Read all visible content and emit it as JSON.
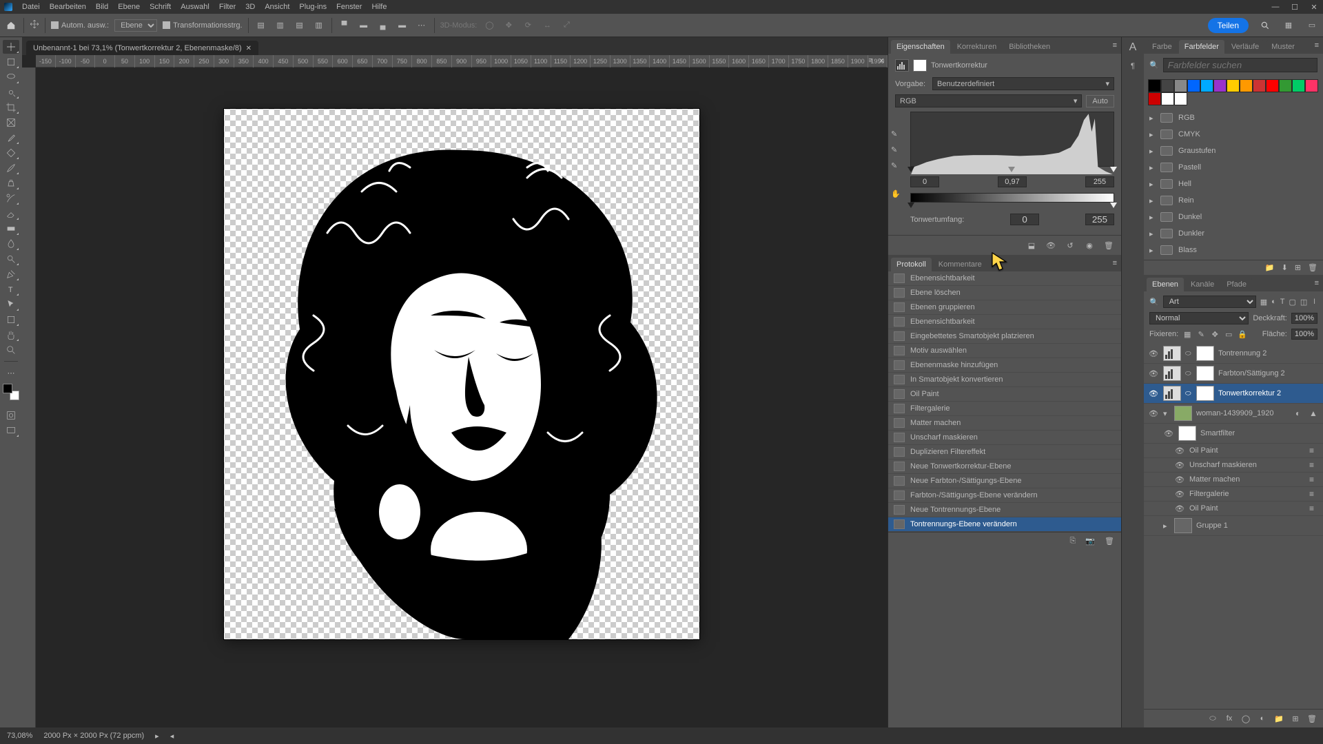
{
  "menu": {
    "items": [
      "Datei",
      "Bearbeiten",
      "Bild",
      "Ebene",
      "Schrift",
      "Auswahl",
      "Filter",
      "3D",
      "Ansicht",
      "Plug-ins",
      "Fenster",
      "Hilfe"
    ]
  },
  "optbar": {
    "auto_select": "Autom. ausw.:",
    "target": "Ebene",
    "transform": "Transformationsstrg.",
    "share": "Teilen",
    "mode3d": "3D-Modus:"
  },
  "tab": {
    "title": "Unbenannt-1 bei 73,1% (Tonwertkorrektur 2, Ebenenmaske/8)"
  },
  "ruler": {
    "ticks": [
      "-150",
      "-100",
      "-50",
      "0",
      "50",
      "100",
      "150",
      "200",
      "250",
      "300",
      "350",
      "400",
      "450",
      "500",
      "550",
      "600",
      "650",
      "700",
      "750",
      "800",
      "850",
      "900",
      "950",
      "1000",
      "1050",
      "1100",
      "1150",
      "1200",
      "1250",
      "1300",
      "1350",
      "1400",
      "1450",
      "1500",
      "1550",
      "1600",
      "1650",
      "1700",
      "1750",
      "1800",
      "1850",
      "1900",
      "1950"
    ]
  },
  "props": {
    "tabs": {
      "eigenschaften": "Eigenschaften",
      "korrekturen": "Korrekturen",
      "bibliotheken": "Bibliotheken"
    },
    "adjust_title": "Tonwertkorrektur",
    "preset_label": "Vorgabe:",
    "preset_value": "Benutzerdefiniert",
    "channel": "RGB",
    "auto": "Auto",
    "in_black": "0",
    "in_gamma": "0,97",
    "in_white": "255",
    "out_label": "Tonwertumfang:",
    "out_black": "0",
    "out_white": "255"
  },
  "history": {
    "tabs": {
      "protokoll": "Protokoll",
      "kommentare": "Kommentare"
    },
    "items": [
      "Ebenensichtbarkeit",
      "Ebene löschen",
      "Ebenen gruppieren",
      "Ebenensichtbarkeit",
      "Eingebettetes Smartobjekt platzieren",
      "Motiv auswählen",
      "Ebenenmaske hinzufügen",
      "In Smartobjekt konvertieren",
      "Oil Paint",
      "Filtergalerie",
      "Matter machen",
      "Unscharf maskieren",
      "Duplizieren Filtereffekt",
      "Neue Tonwertkorrektur-Ebene",
      "Neue Farbton-/Sättigungs-Ebene",
      "Farbton-/Sättigungs-Ebene verändern",
      "Neue Tontrennungs-Ebene",
      "Tontrennungs-Ebene verändern"
    ],
    "selected_index": 17
  },
  "color_tabs": {
    "farbe": "Farbe",
    "farbfelder": "Farbfelder",
    "verlaeufe": "Verläufe",
    "muster": "Muster"
  },
  "swatch_search": "Farbfelder suchen",
  "swatch_colors": [
    "#000000",
    "#444444",
    "#888888",
    "#0066ff",
    "#00aaff",
    "#9933cc",
    "#ffcc00",
    "#ff9900",
    "#cc3333",
    "#ff0000",
    "#339933",
    "#00cc66",
    "#ff3366",
    "#cc0000",
    "#ffffff",
    "#ffffff"
  ],
  "swatch_folders": [
    "RGB",
    "CMYK",
    "Graustufen",
    "Pastell",
    "Hell",
    "Rein",
    "Dunkel",
    "Dunkler",
    "Blass"
  ],
  "layers": {
    "tabs": {
      "ebenen": "Ebenen",
      "kanaele": "Kanäle",
      "pfade": "Pfade"
    },
    "filter": "Art",
    "blend": "Normal",
    "opacity_label": "Deckkraft:",
    "opacity": "100%",
    "lock_label": "Fixieren:",
    "fill_label": "Fläche:",
    "fill": "100%",
    "items": [
      {
        "name": "Tontrennung 2",
        "type": "adj"
      },
      {
        "name": "Farbton/Sättigung 2",
        "type": "adj"
      },
      {
        "name": "Tonwertkorrektur 2",
        "type": "adj",
        "selected": true
      },
      {
        "name": "woman-1439909_1920",
        "type": "smart",
        "expanded": true
      },
      {
        "name": "Smartfilter",
        "type": "sfhead"
      },
      {
        "name": "Oil Paint",
        "type": "sf"
      },
      {
        "name": "Unscharf maskieren",
        "type": "sf"
      },
      {
        "name": "Matter machen",
        "type": "sf"
      },
      {
        "name": "Filtergalerie",
        "type": "sf"
      },
      {
        "name": "Oil Paint",
        "type": "sf"
      },
      {
        "name": "Gruppe 1",
        "type": "group"
      }
    ]
  },
  "status": {
    "zoom": "73,08%",
    "docinfo": "2000 Px × 2000 Px (72 ppcm)"
  }
}
